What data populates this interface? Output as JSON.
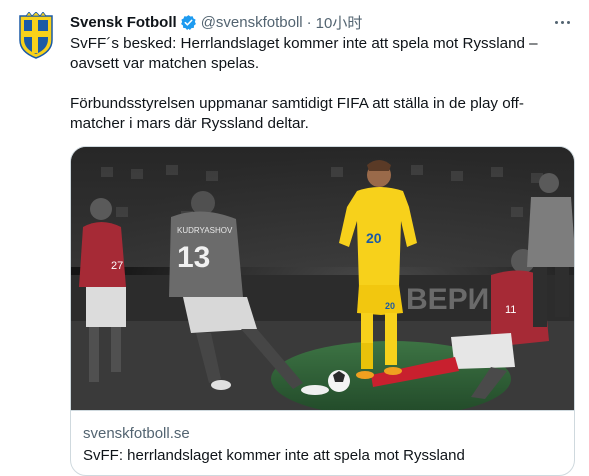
{
  "account": {
    "name": "Svensk Fotboll",
    "handle": "@svenskfotboll",
    "separator": "·",
    "time": "10小时",
    "verified_icon": "verified-badge-icon",
    "avatar_icon": "svff-crest-icon"
  },
  "colors": {
    "verified_blue": "#1d9bf0",
    "sweden_yellow": "#f7d11b",
    "russia_red": "#a62a36",
    "pitch_green": "#2e6b3a",
    "crest_blue": "#1b5aa6"
  },
  "tweet": {
    "paragraph1_line1": "SvFF´s besked: Herrlandslaget kommer inte att spela mot Ryssland –",
    "paragraph1_line2": "oavsett var matchen spelas.",
    "paragraph2_line1": "Förbundsstyrelsen uppmanar samtidigt FIFA att ställa in de play off-",
    "paragraph2_line2": "matcher i mars där Ryssland deltar."
  },
  "card": {
    "domain": "svenskfotboll.se",
    "title": "SvFF: herrlandslaget kommer inte att spela mot Ryssland",
    "image": {
      "center_player_number": "20",
      "left_player_number": "13",
      "left_player_name": "KUDRYASHOV",
      "left2_player_number": "27",
      "right_player_number": "11",
      "shorts_number": "20",
      "board_text": "ВЕРИ"
    }
  },
  "menu": {
    "more_icon": "more-options-icon"
  }
}
